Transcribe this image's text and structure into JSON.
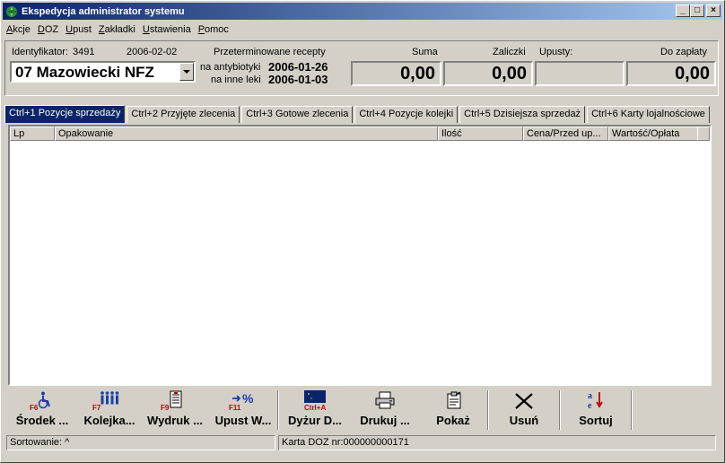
{
  "window": {
    "title": "Ekspedycja administrator systemu"
  },
  "window_buttons": {
    "minimize": "_",
    "maximize": "□",
    "close": "×"
  },
  "menu": [
    {
      "label": "Akcje",
      "u": "A",
      "rest": "kcje"
    },
    {
      "label": "DOZ",
      "u": "D",
      "rest": "OZ"
    },
    {
      "label": "Upust",
      "u": "U",
      "rest": "pust"
    },
    {
      "label": "Zakładki",
      "u": "Z",
      "rest": "akładki"
    },
    {
      "label": "Ustawienia",
      "u": "U",
      "rest": "stawienia"
    },
    {
      "label": "Pomoc",
      "u": "P",
      "rest": "omoc"
    }
  ],
  "header": {
    "identifier_label": "Identyfikator:",
    "identifier_value": "3491",
    "date": "2006-02-02",
    "payer": "07 Mazowiecki NFZ",
    "expired_label": "Przeterminowane recepty",
    "antibiotics_label": "na antybiotyki",
    "antibiotics_date": "2006-01-26",
    "other_label": "na inne leki",
    "other_date": "2006-01-03",
    "suma_label": "Suma",
    "suma_value": "0,00",
    "zaliczki_label": "Zaliczki",
    "zaliczki_value": "0,00",
    "upusty_label": "Upusty:",
    "upusty_value": "",
    "do_zaplaty_label": "Do zapłaty",
    "do_zaplaty_value": "0,00"
  },
  "tabs": [
    "Ctrl+1 Pozycje sprzedaży",
    "Ctrl+2 Przyjęte zlecenia",
    "Ctrl+3 Gotowe zlecenia",
    "Ctrl+4 Pozycje kolejki",
    "Ctrl+5 Dzisiejsza sprzedaż",
    "Ctrl+6 Karty lojalnościowe"
  ],
  "grid": {
    "columns": [
      "Lp",
      "Opakowanie",
      "Ilość",
      "Cena/Przed up...",
      "Wartość/Opłata"
    ]
  },
  "toolbar": [
    {
      "key": "F6",
      "label": "Środek ...",
      "icon": "wheelchair-icon"
    },
    {
      "key": "F7",
      "label": "Kolejka...",
      "icon": "people-queue-icon"
    },
    {
      "key": "F9",
      "label": "Wydruk ...",
      "icon": "document-print-icon"
    },
    {
      "key": "F11",
      "label": "Upust W...",
      "icon": "discount-percent-icon"
    },
    {
      "key": "Ctrl+A",
      "label": "Dyżur D...",
      "icon": "moon-night-icon"
    },
    {
      "key": "",
      "label": "Drukuj ...",
      "icon": "printer-icon"
    },
    {
      "key": "",
      "label": "Pokaż",
      "icon": "clipboard-icon"
    },
    {
      "key": "",
      "label": "Usuń",
      "icon": "delete-x-icon"
    },
    {
      "key": "",
      "label": "Sortuj",
      "icon": "sort-icon"
    }
  ],
  "status": {
    "sort": "Sortowanie: ^",
    "card": "Karta DOZ nr:000000000171"
  }
}
